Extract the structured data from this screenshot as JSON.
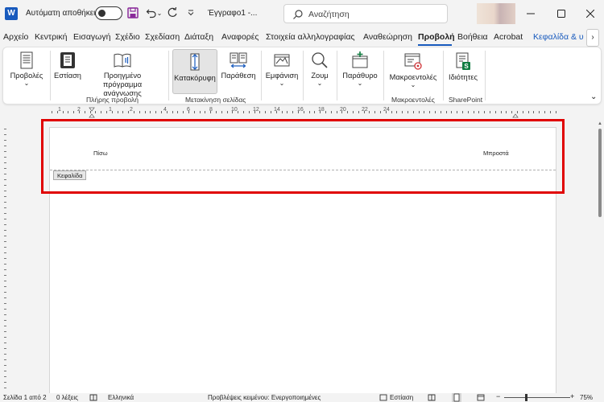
{
  "titlebar": {
    "autosave_label": "Αυτόματη αποθήκευση",
    "doc_title": "Έγγραφο1  -...",
    "search_placeholder": "Αναζήτηση"
  },
  "tabs": [
    {
      "label": "Αρχείο"
    },
    {
      "label": "Κεντρική"
    },
    {
      "label": "Εισαγωγή"
    },
    {
      "label": "Σχέδιο"
    },
    {
      "label": "Σχεδίαση"
    },
    {
      "label": "Διάταξη"
    },
    {
      "label": "Αναφορές"
    },
    {
      "label": "Στοιχεία αλληλογραφίας"
    },
    {
      "label": "Αναθεώρηση"
    },
    {
      "label": "Προβολή"
    },
    {
      "label": "Βοήθεια"
    },
    {
      "label": "Acrobat"
    },
    {
      "label": "Κεφαλίδα & υ"
    }
  ],
  "ribbon": {
    "views": "Προβολές",
    "focus": "Εστίαση",
    "immersive_line1": "Προηγμένο",
    "immersive_line2": "πρόγραμμα ανάγνωσης",
    "vertical": "Κατακόρυφη",
    "side_to_side": "Παράθεση",
    "show": "Εμφάνιση",
    "zoom": "Ζουμ",
    "window": "Παράθυρο",
    "macros": "Μακροεντολές",
    "properties": "Ιδιότητες",
    "groups": {
      "immersive": "Πλήρης προβολή",
      "page_movement": "Μετακίνηση σελίδας",
      "macros": "Μακροεντολές",
      "sharepoint": "SharePoint"
    }
  },
  "ruler": {
    "numbers": [
      "1",
      "2",
      "1",
      "2",
      "4",
      "6",
      "8",
      "10",
      "12",
      "14",
      "16",
      "18",
      "20",
      "22",
      "24"
    ]
  },
  "document": {
    "header_left": "Πίσω",
    "header_right": "Μπροστά",
    "header_tag": "Κεφαλίδα"
  },
  "statusbar": {
    "page": "Σελίδα 1 από 2",
    "words": "0 λέξεις",
    "language": "Ελληνικά",
    "predictions": "Προβλέψεις κειμένου: Ενεργοποιημένες",
    "focus": "Εστίαση",
    "zoom": "75%"
  },
  "colors": {
    "accent": "#185abd",
    "highlight": "#e00000",
    "sharepoint": "#107c41"
  }
}
